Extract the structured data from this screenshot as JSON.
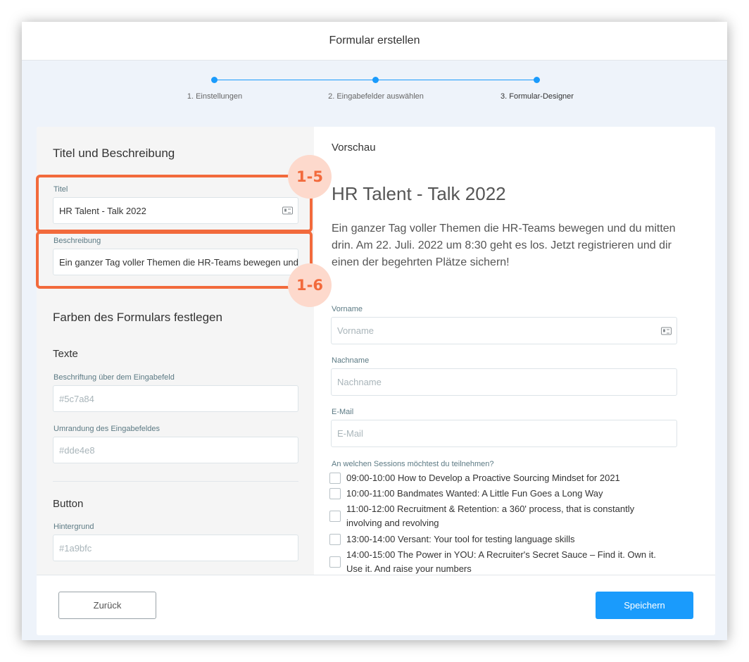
{
  "modal": {
    "title": "Formular erstellen"
  },
  "stepper": {
    "steps": [
      {
        "label": "1. Einstellungen"
      },
      {
        "label": "2. Eingabefelder auswählen"
      },
      {
        "label": "3. Formular-Designer"
      }
    ]
  },
  "left": {
    "section_title": "Titel und Beschreibung",
    "title_label": "Titel",
    "title_value": "HR Talent - Talk 2022",
    "desc_label": "Beschreibung",
    "desc_value": "Ein ganzer Tag voller Themen die HR-Teams bewegen und du mitten drin.",
    "colors_title": "Farben des Formulars festlegen",
    "texts_subtitle": "Texte",
    "label_color_label": "Beschriftung über dem Eingabefeld",
    "label_color_placeholder": "#5c7a84",
    "border_color_label": "Umrandung des Eingabefeldes",
    "border_color_placeholder": "#dde4e8",
    "button_subtitle": "Button",
    "bg_label": "Hintergrund",
    "bg_placeholder": "#1a9bfc"
  },
  "preview": {
    "heading": "Vorschau",
    "title": "HR Talent - Talk 2022",
    "description": "Ein ganzer Tag voller Themen die HR-Teams bewegen und du mitten drin. Am 22. Juli. 2022 um 8:30 geht es los. Jetzt registrieren und dir einen der begehrten Plätze sichern!",
    "firstname_label": "Vorname",
    "firstname_placeholder": "Vorname",
    "lastname_label": "Nachname",
    "lastname_placeholder": "Nachname",
    "email_label": "E-Mail",
    "email_placeholder": "E-Mail",
    "sessions_label": "An welchen Sessions möchtest du teilnehmen?",
    "sessions": [
      "09:00-10:00 How to Develop a Proactive Sourcing Mindset for 2021",
      "10:00-11:00 Bandmates Wanted: A Little Fun Goes a Long Way",
      "11:00-12:00 Recruitment & Retention: a 360' process, that is constantly involving and revolving",
      "13:00-14:00 Versant: Your tool for testing language skills",
      "14:00-15:00 The Power in YOU: A Recruiter's Secret Sauce – Find it. Own it. Use it. And raise your numbers"
    ]
  },
  "footer": {
    "back_label": "Zurück",
    "save_label": "Speichern"
  },
  "annotations": {
    "badge_1": "1-5",
    "badge_2": "1-6"
  },
  "colors": {
    "accent": "#1a9bfc",
    "highlight": "#f26a3c",
    "label": "#5c7a84",
    "border": "#dde4e8"
  }
}
